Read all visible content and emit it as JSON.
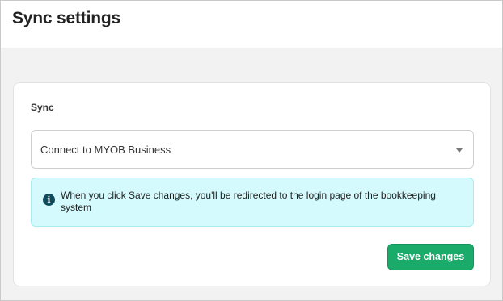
{
  "header": {
    "title": "Sync settings"
  },
  "sync_card": {
    "section_label": "Sync",
    "select": {
      "selected_value": "Connect to MYOB Business",
      "icon": "chevron-down-icon"
    },
    "info": {
      "icon": "info-icon",
      "icon_glyph": "i",
      "message": "When you click Save changes, you'll be redirected to the login page of the bookkeeping system"
    },
    "save_label": "Save changes"
  },
  "colors": {
    "page_background": "#f2f2f2",
    "info_background": "#d4fafd",
    "info_icon": "#0f4a5c",
    "primary_button": "#1aab6b"
  }
}
